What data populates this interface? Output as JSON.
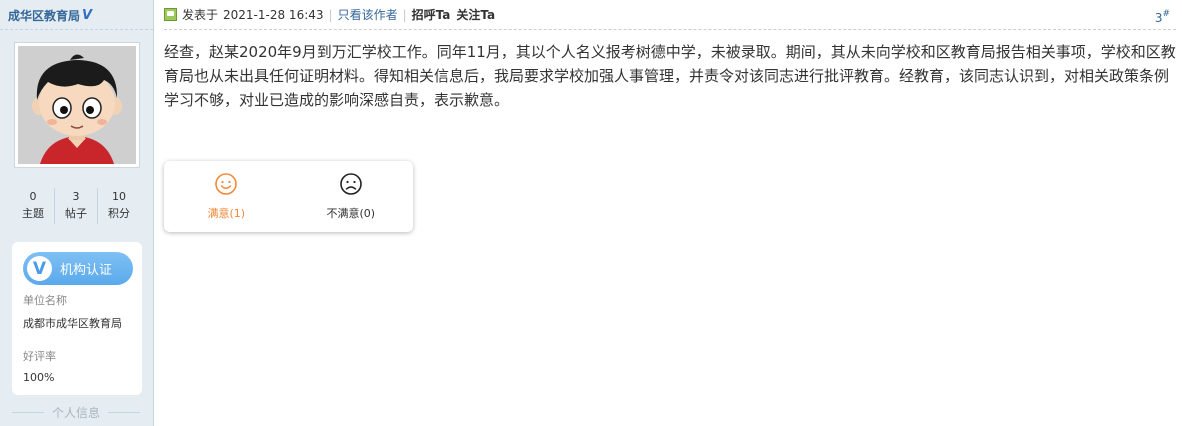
{
  "author": {
    "name": "成华区教育局",
    "verified_mark": "V",
    "stats": [
      {
        "value": "0",
        "label": "主题"
      },
      {
        "value": "3",
        "label": "帖子"
      },
      {
        "value": "10",
        "label": "积分"
      }
    ],
    "cert_label": "机构认证",
    "cert_icon_char": "V",
    "unit_label": "单位名称",
    "unit_value": "成都市成华区教育局",
    "rating_label": "好评率",
    "rating_value": "100%",
    "personal_info": "个人信息"
  },
  "post": {
    "posted_prefix": "发表于",
    "posted_time": "2021-1-28 16:43",
    "only_author": "只看该作者",
    "greet": "招呼Ta",
    "follow": "关注Ta",
    "floor_number": "3",
    "floor_mark": "#",
    "body": "经查，赵某2020年9月到万汇学校工作。同年11月，其以个人名义报考树德中学，未被录取。期间，其从未向学校和区教育局报告相关事项，学校和区教育局也从未出具任何证明材料。得知相关信息后，我局要求学校加强人事管理，并责令对该同志进行批评教育。经教育，该同志认识到，对相关政策条例学习不够，对业已造成的影响深感自责，表示歉意。"
  },
  "rating": {
    "satisfied": "满意(1)",
    "dissatisfied": "不满意(0)"
  },
  "colors": {
    "sidebar_bg": "#e5edf2",
    "link": "#336699",
    "satisfied": "#f0893a",
    "cert_pill": "#5aa9ec"
  }
}
